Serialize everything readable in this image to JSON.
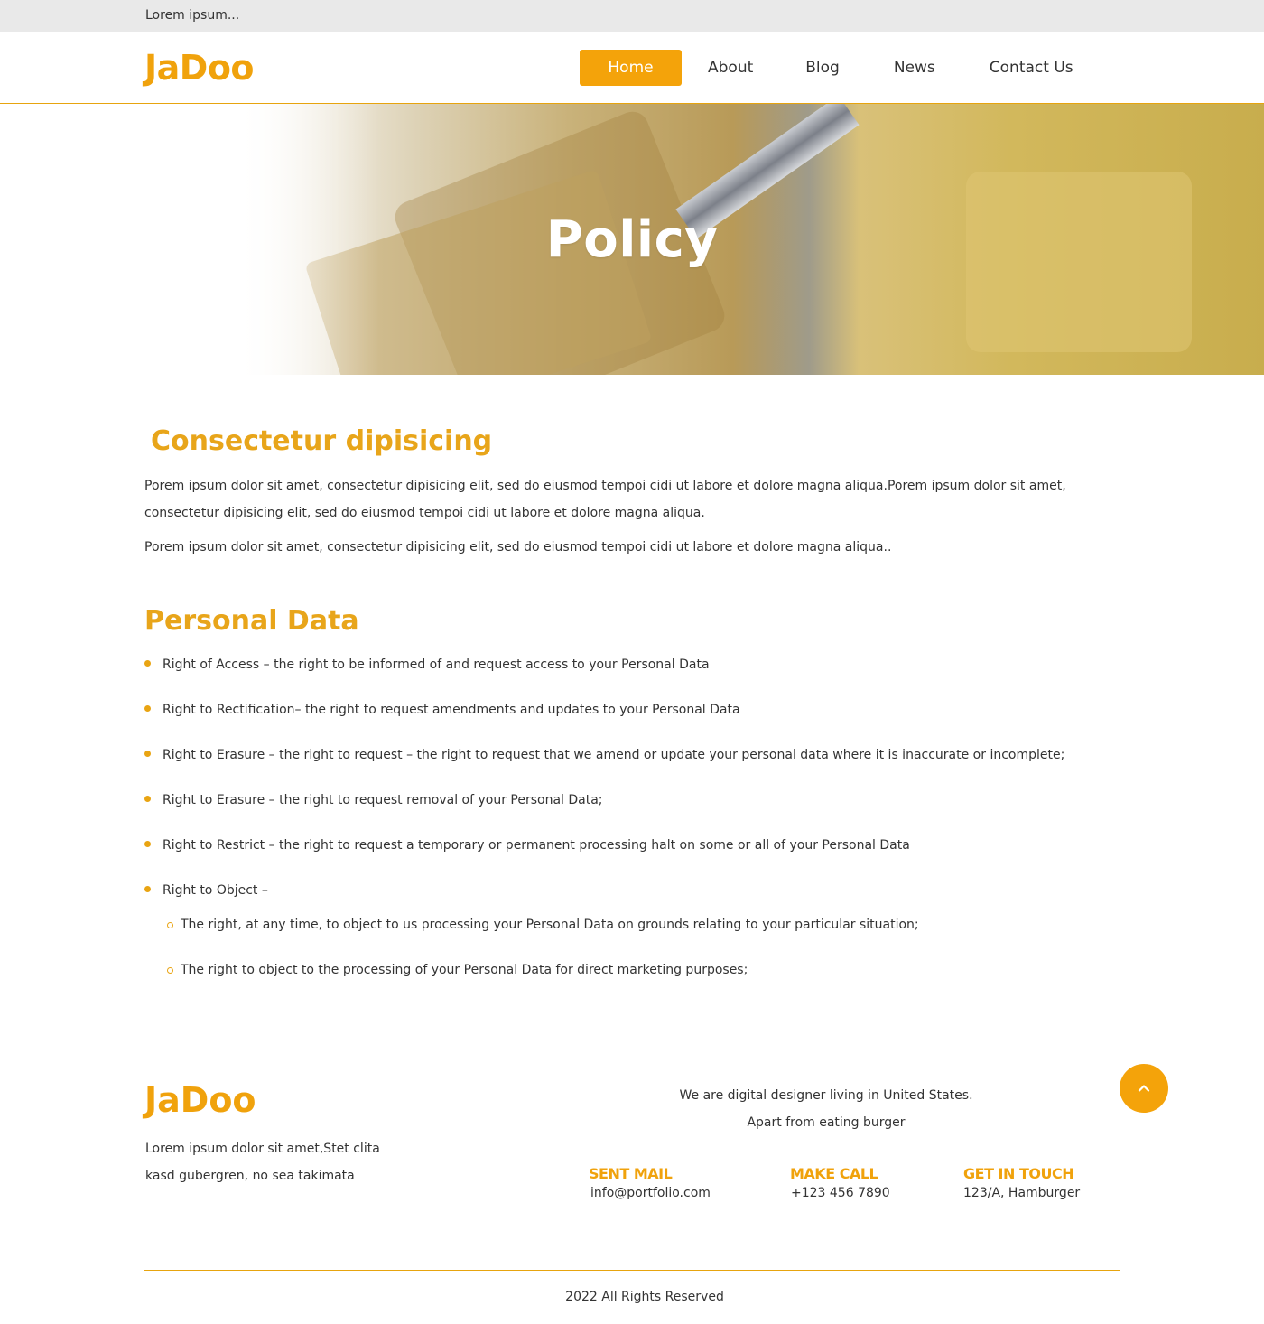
{
  "topbar": {
    "text": "Lorem ipsum..."
  },
  "header": {
    "logo": "JaDoo",
    "nav": [
      {
        "label": "Home",
        "active": true
      },
      {
        "label": "About",
        "active": false
      },
      {
        "label": "Blog",
        "active": false
      },
      {
        "label": "News",
        "active": false
      },
      {
        "label": "Contact Us",
        "active": false
      }
    ]
  },
  "hero": {
    "title": "Policy"
  },
  "intro": {
    "heading": "Consectetur dipisicing",
    "paragraphs": [
      "Porem ipsum dolor sit amet, consectetur dipisicing elit, sed do eiusmod tempoi cidi ut labore et dolore magna aliqua.Porem ipsum dolor sit amet, consectetur dipisicing elit, sed do eiusmod tempoi cidi ut labore et dolore magna aliqua.",
      "Porem ipsum dolor sit amet, consectetur dipisicing elit, sed do eiusmod tempoi cidi ut labore et dolore magna aliqua.."
    ]
  },
  "personal_data": {
    "heading": "Personal Data",
    "items": [
      "Right of Access – the right to be informed of and request access to your Personal Data",
      "Right to Rectification– the right to request amendments and updates to your Personal Data",
      "Right to Erasure – the right to request – the right to request that we amend or update your personal data where it is inaccurate or incomplete;",
      "Right to Erasure – the right to request removal of your Personal Data;",
      "Right to Restrict – the right to request a temporary or permanent processing halt on some or all of your Personal Data",
      "Right to Object –"
    ],
    "object_items": [
      "The right, at any time, to object to us processing your Personal Data on grounds relating to your particular situation;",
      "The right to object to the processing of your Personal Data for direct marketing purposes;"
    ]
  },
  "footer": {
    "logo": "JaDoo",
    "about_lines": [
      "Lorem ipsum dolor sit amet,Stet clita",
      "kasd gubergren, no sea takimata"
    ],
    "tagline_lines": [
      "We are digital designer living in United States.",
      "Apart from eating burger"
    ],
    "contacts": [
      {
        "title": "SENT MAIL",
        "value": "info@portfolio.com"
      },
      {
        "title": "MAKE CALL",
        "value": "+123 456 7890"
      },
      {
        "title": "GET IN TOUCH",
        "value": "123/A, Hamburger"
      }
    ],
    "copyright": "2022 All Rights Reserved"
  },
  "colors": {
    "accent": "#f4a30a",
    "heading": "#e8a51a",
    "text": "#333333",
    "topbar": "#e9e9e9"
  },
  "icons": {
    "back_to_top": "chevron-up-icon"
  }
}
